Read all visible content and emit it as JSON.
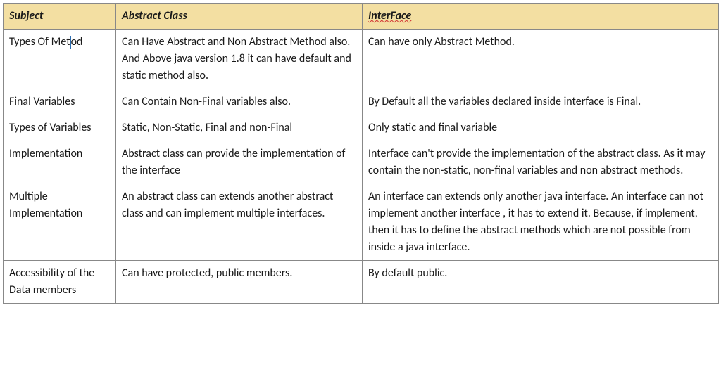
{
  "headers": {
    "col1": "Subject",
    "col2": "Abstract Class",
    "col3": "InterFace"
  },
  "rows": [
    {
      "subject_a": "Types Of Met",
      "subject_b": "od",
      "abstract": "Can Have Abstract and Non Abstract Method also. And Above java version 1.8 it can have default and static method also.",
      "interface": "Can have only Abstract Method."
    },
    {
      "subject": "Final Variables",
      "abstract": "Can Contain Non-Final variables also.",
      "interface": "By Default all the variables declared inside interface is Final."
    },
    {
      "subject": "Types of Variables",
      "abstract": "Static, Non-Static, Final and non-Final",
      "interface": "Only static and final variable"
    },
    {
      "subject": "Implementation",
      "abstract": "Abstract class can provide the implementation of the interface",
      "interface": "Interface can't provide the implementation of the abstract class. As it may contain the non-static, non-final    variables and non abstract methods."
    },
    {
      "subject": "Multiple Implementation",
      "abstract": "An abstract class can extends another abstract class and can implement multiple interfaces.",
      "interface": "An interface can extends only another java interface. An interface can not implement another interface , it has to extend it. Because, if implement, then it has to define the abstract methods which are not possible from inside a java interface."
    },
    {
      "subject": "Accessibility of the Data members",
      "abstract": "Can have protected, public members.",
      "interface": "By default public."
    }
  ],
  "chart_data": {
    "type": "table",
    "title": "Abstract Class vs Interface",
    "columns": [
      "Subject",
      "Abstract Class",
      "InterFace"
    ],
    "rows": [
      [
        "Types Of Method",
        "Can Have Abstract and Non Abstract Method also. And Above java version 1.8 it can have default and static method also.",
        "Can have only Abstract Method."
      ],
      [
        "Final Variables",
        "Can Contain Non-Final variables also.",
        "By Default all the variables declared inside interface is Final."
      ],
      [
        "Types of Variables",
        "Static, Non-Static, Final and non-Final",
        "Only static and final variable"
      ],
      [
        "Implementation",
        "Abstract class can provide the implementation of the interface",
        "Interface can't provide the implementation of the abstract class. As it may contain the non-static, non-final variables and non abstract methods."
      ],
      [
        "Multiple Implementation",
        "An abstract class can extends another abstract class and can implement multiple interfaces.",
        "An interface can extends only another java interface. An interface can not implement another interface , it has to extend it. Because, if implement, then it has to define the abstract methods which are not possible from inside a java interface."
      ],
      [
        "Accessibility of the Data members",
        "Can have protected, public members.",
        "By default public."
      ]
    ]
  }
}
